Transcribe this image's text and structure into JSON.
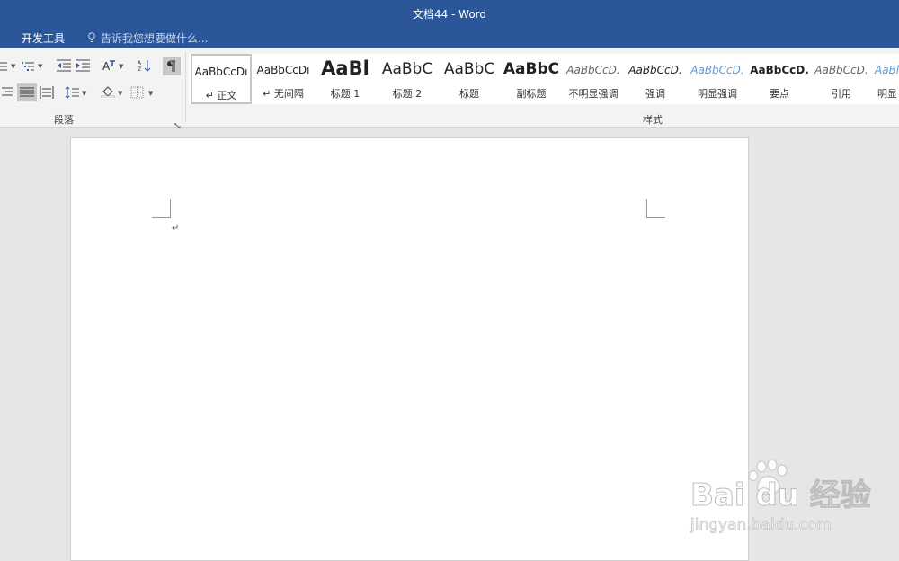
{
  "window": {
    "title": "文档44 - Word"
  },
  "ribbon_tabs": {
    "developer": "开发工具"
  },
  "tell_me": {
    "placeholder": "告诉我您想要做什么..."
  },
  "groups": {
    "paragraph_label": "段落",
    "styles_label": "样式"
  },
  "styles": [
    {
      "sample": "AaBbCcDı",
      "name": "↵ 正文"
    },
    {
      "sample": "AaBbCcDı",
      "name": "↵ 无间隔"
    },
    {
      "sample": "AaBl",
      "name": "标题 1"
    },
    {
      "sample": "AaBbC",
      "name": "标题 2"
    },
    {
      "sample": "AaBbC",
      "name": "标题"
    },
    {
      "sample": "AaBbC",
      "name": "副标题"
    },
    {
      "sample": "AaBbCcD.",
      "name": "不明显强调"
    },
    {
      "sample": "AaBbCcD.",
      "name": "强调"
    },
    {
      "sample": "AaBbCcD.",
      "name": "明显强调"
    },
    {
      "sample": "AaBbCcD.",
      "name": "要点"
    },
    {
      "sample": "AaBbCcD.",
      "name": "引用"
    },
    {
      "sample": "AaBl",
      "name": "明显"
    }
  ],
  "document": {
    "paragraph_mark": "↵"
  },
  "watermark": {
    "brand": "Bai du 经验",
    "url": "jingyan.baidu.com"
  },
  "colors": {
    "titlebar": "#2b579a",
    "ribbon": "#f3f3f3",
    "workspace": "#e6e6e6",
    "subtle_emphasis": "#5b9bd5"
  }
}
